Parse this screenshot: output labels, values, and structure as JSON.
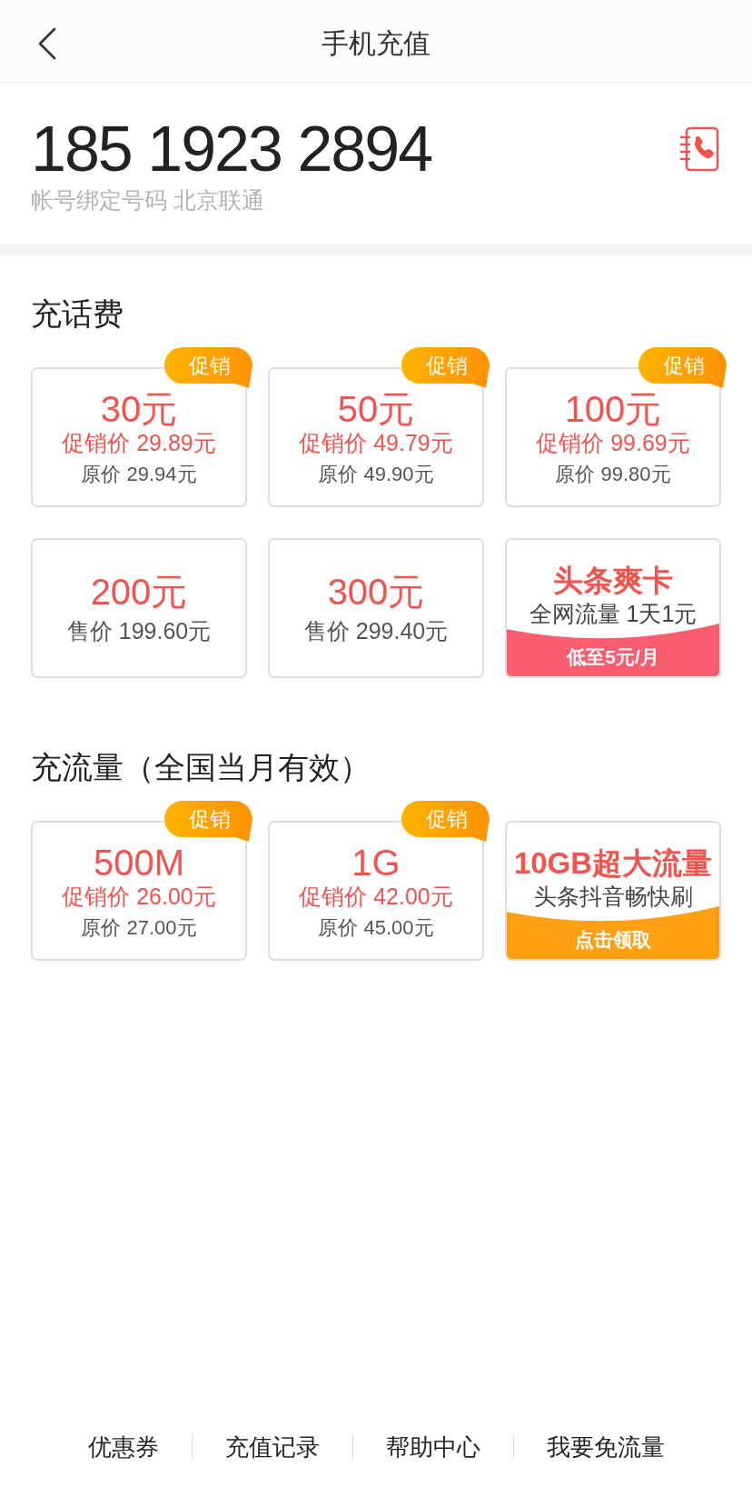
{
  "header": {
    "title": "手机充值"
  },
  "account": {
    "phone": "185 1923 2894",
    "note": "帐号绑定号码 北京联通"
  },
  "sections": [
    {
      "title": "充话费",
      "cards": [
        {
          "kind": "promo",
          "badge": "促销",
          "amount": "30元",
          "price": "促销价 29.89元",
          "original": "原价 29.94元"
        },
        {
          "kind": "promo",
          "badge": "促销",
          "amount": "50元",
          "price": "促销价 49.79元",
          "original": "原价 49.90元"
        },
        {
          "kind": "promo",
          "badge": "促销",
          "amount": "100元",
          "price": "促销价 99.69元",
          "original": "原价 99.80元"
        },
        {
          "kind": "plain",
          "amount": "200元",
          "price": "售价 199.60元"
        },
        {
          "kind": "plain",
          "amount": "300元",
          "price": "售价 299.40元"
        },
        {
          "kind": "banner",
          "title": "头条爽卡",
          "subtitle": "全网流量 1天1元",
          "band": "低至5元/月",
          "color": "#fa5d6e"
        }
      ]
    },
    {
      "title": "充流量（全国当月有效）",
      "cards": [
        {
          "kind": "promo",
          "badge": "促销",
          "amount": "500M",
          "price": "促销价 26.00元",
          "original": "原价 27.00元"
        },
        {
          "kind": "promo",
          "badge": "促销",
          "amount": "1G",
          "price": "促销价 42.00元",
          "original": "原价 45.00元"
        },
        {
          "kind": "banner",
          "title": "10GB超大流量",
          "subtitle": "头条抖音畅快刷",
          "band": "点击领取",
          "color": "#ffa012"
        }
      ]
    }
  ],
  "footer": {
    "links": [
      "优惠券",
      "充值记录",
      "帮助中心",
      "我要免流量"
    ]
  }
}
